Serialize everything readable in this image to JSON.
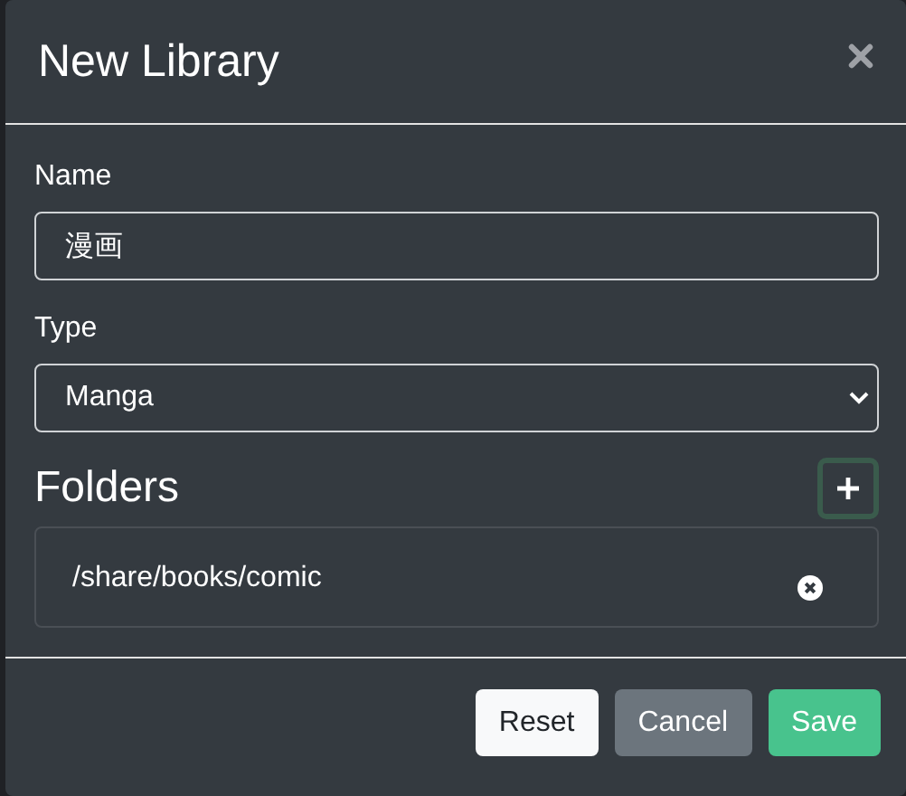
{
  "dialog": {
    "title": "New Library"
  },
  "name_field": {
    "label": "Name",
    "value": "漫画"
  },
  "type_field": {
    "label": "Type",
    "value": "Manga"
  },
  "folders": {
    "heading": "Folders",
    "items": [
      {
        "path": "/share/books/comic"
      }
    ]
  },
  "buttons": [
    {
      "label": "Reset",
      "kind": "light"
    },
    {
      "label": "Cancel",
      "kind": "secondary"
    },
    {
      "label": "Save",
      "kind": "primary"
    }
  ]
}
